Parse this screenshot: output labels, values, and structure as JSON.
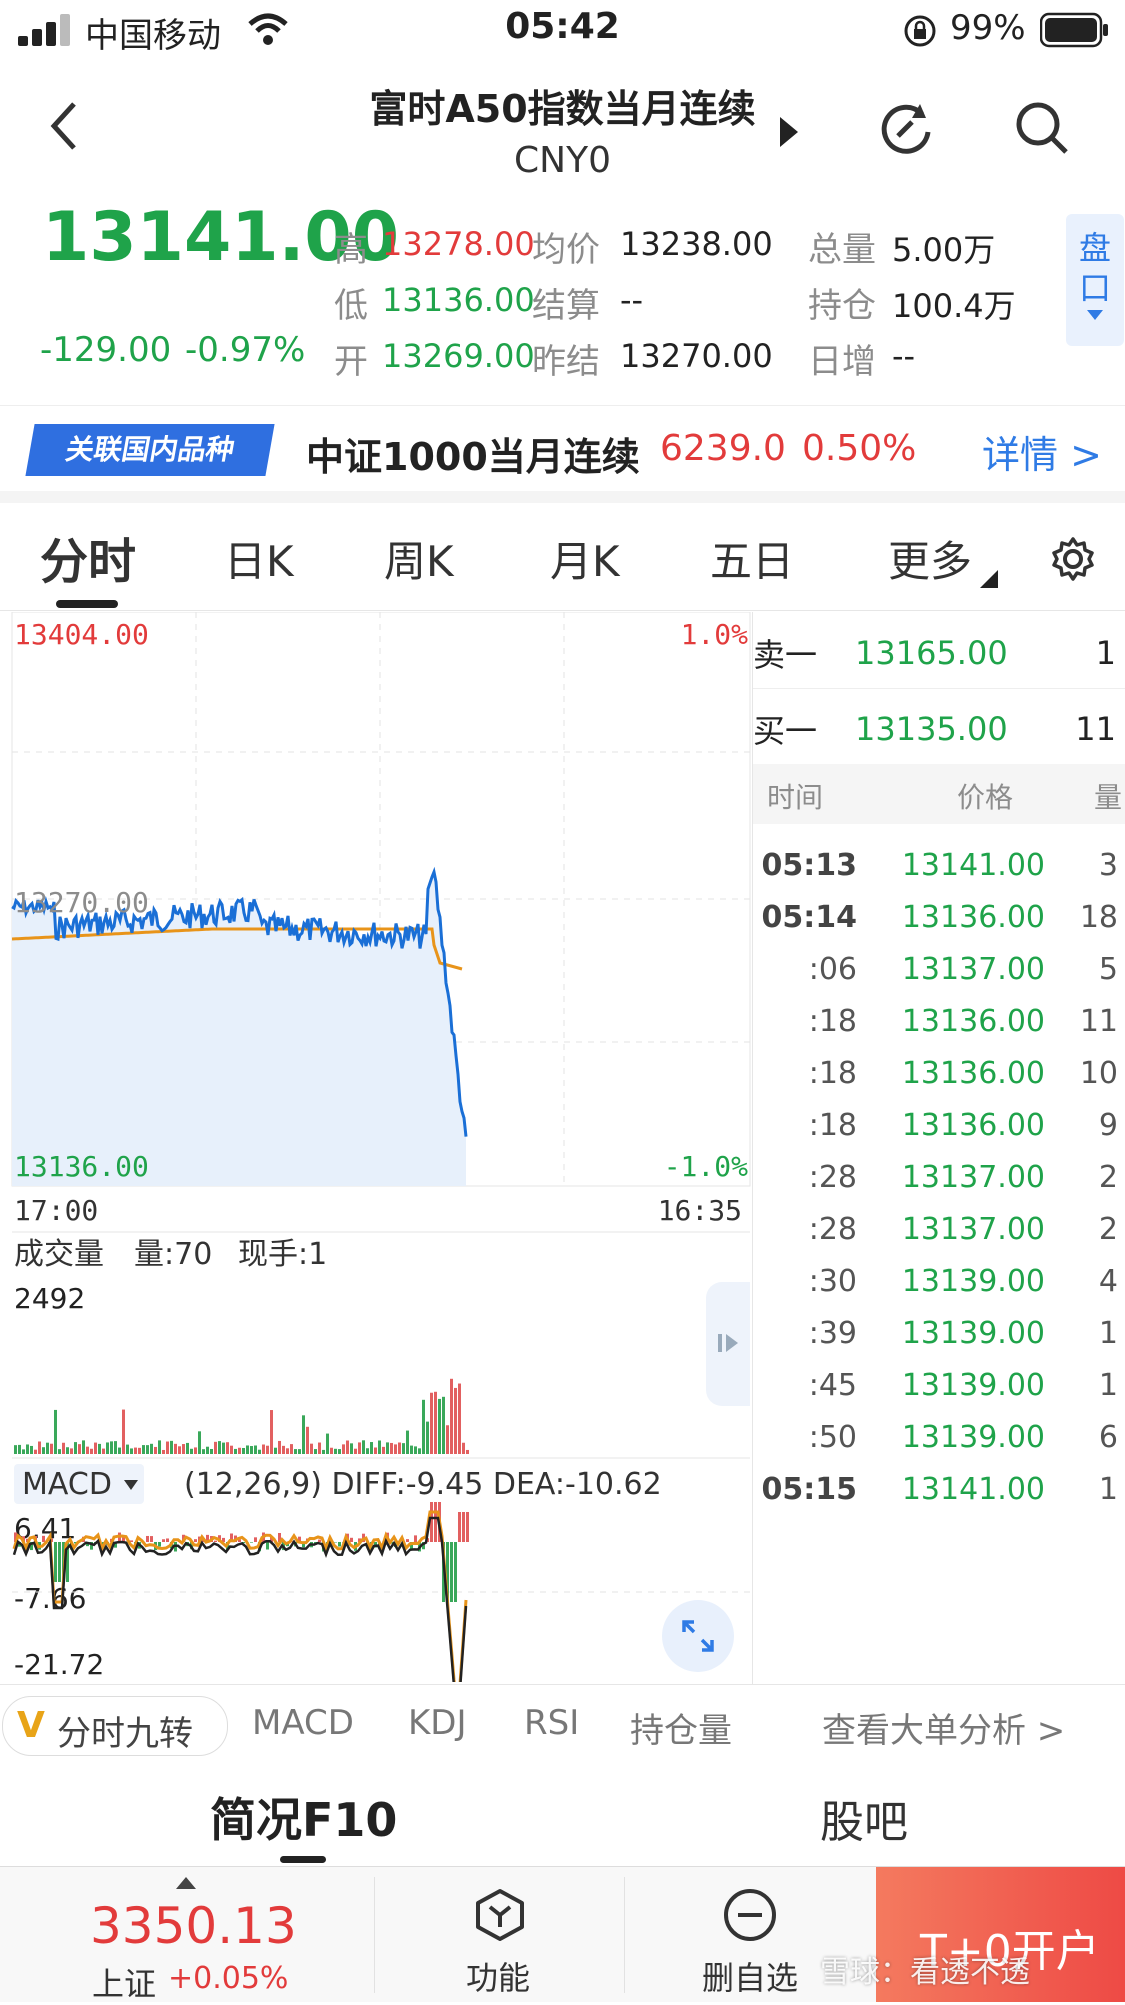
{
  "status_bar": {
    "carrier": "中国移动",
    "time": "05:42",
    "battery": "99%"
  },
  "header": {
    "title": "富时A50指数当月连续",
    "code": "CNY0"
  },
  "quote": {
    "price": "13141.00",
    "change": "-129.00",
    "change_pct": "-0.97%",
    "high_label": "高",
    "high": "13278.00",
    "low_label": "低",
    "low": "13136.00",
    "open_label": "开",
    "open": "13269.00",
    "avg_label": "均价",
    "avg": "13238.00",
    "settle_label": "结算",
    "settle": "--",
    "prev_settle_label": "昨结",
    "prev_settle": "13270.00",
    "volume_label": "总量",
    "volume": "5.00万",
    "oi_label": "持仓",
    "oi": "100.4万",
    "daily_inc_label": "日增",
    "daily_inc": "--",
    "panel_btn": "盘口"
  },
  "related": {
    "badge": "关联国内品种",
    "name": "中证1000当月连续",
    "price": "6239.0",
    "pct": "0.50%",
    "detail": "详情 >"
  },
  "tabs": [
    "分时",
    "日K",
    "周K",
    "月K",
    "五日",
    "更多"
  ],
  "chart": {
    "y_top": "13404.00",
    "y_mid": "13270.00",
    "y_bottom": "13136.00",
    "pct_top": "1.0%",
    "pct_bottom": "-1.0%",
    "x_start": "17:00",
    "x_end": "16:35"
  },
  "volume_panel": {
    "title": "成交量",
    "vol_label": "量:70",
    "hand_label": "现手:1",
    "max": "2492"
  },
  "macd_panel": {
    "name": "MACD",
    "params": "(12,26,9) DIFF:-9.45 DEA:-10.62",
    "top": "6.41",
    "mid": "-7.66",
    "bottom": "-21.72"
  },
  "orderbook": {
    "sell_label": "卖一",
    "sell_price": "13165.00",
    "sell_vol": "1",
    "buy_label": "买一",
    "buy_price": "13135.00",
    "buy_vol": "11",
    "headers": [
      "时间",
      "价格",
      "量"
    ],
    "ticks": [
      {
        "t": "05:13",
        "p": "13141.00",
        "v": "3"
      },
      {
        "t": "05:14",
        "p": "13136.00",
        "v": "18"
      },
      {
        "t": ":06",
        "p": "13137.00",
        "v": "5"
      },
      {
        "t": ":18",
        "p": "13136.00",
        "v": "11"
      },
      {
        "t": ":18",
        "p": "13136.00",
        "v": "10"
      },
      {
        "t": ":18",
        "p": "13136.00",
        "v": "9"
      },
      {
        "t": ":28",
        "p": "13137.00",
        "v": "2"
      },
      {
        "t": ":28",
        "p": "13137.00",
        "v": "2"
      },
      {
        "t": ":30",
        "p": "13139.00",
        "v": "4"
      },
      {
        "t": ":39",
        "p": "13139.00",
        "v": "1"
      },
      {
        "t": ":45",
        "p": "13139.00",
        "v": "1"
      },
      {
        "t": ":50",
        "p": "13139.00",
        "v": "6"
      },
      {
        "t": "05:15",
        "p": "13141.00",
        "v": "1"
      }
    ]
  },
  "indicator_tabs": {
    "jiuzhuan": "分时九转",
    "macd": "MACD",
    "kdj": "KDJ",
    "rsi": "RSI",
    "oi": "持仓量",
    "big_order": "查看大单分析 >"
  },
  "bottom_tabs": {
    "f10": "简况F10",
    "guba": "股吧"
  },
  "bottom_bar": {
    "index_value": "3350.13",
    "index_name": "上证",
    "index_pct": "+0.05%",
    "func": "功能",
    "remove": "删自选",
    "open_account": "T+0开户",
    "watermark": "雪球：看透不透"
  },
  "colors": {
    "up": "#e23b3b",
    "down": "#1fa34a",
    "price_line": "#1a6fd6",
    "avg_line": "#e8941a",
    "accent": "#2f7be5"
  }
}
